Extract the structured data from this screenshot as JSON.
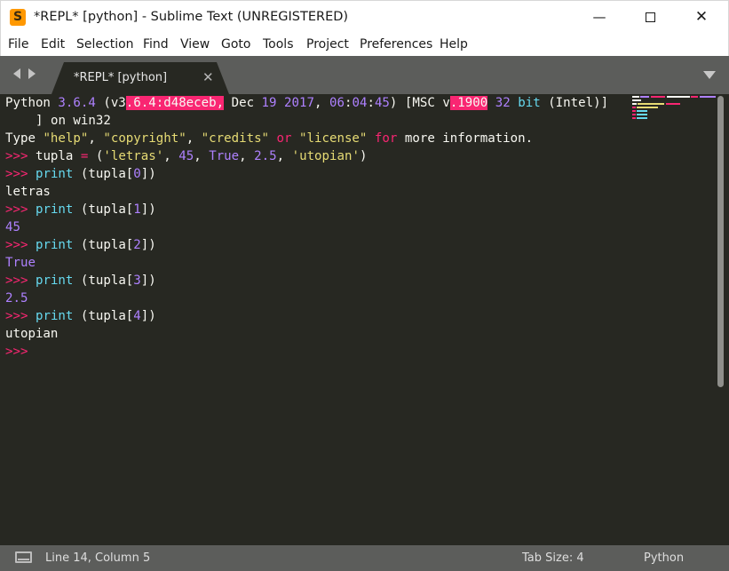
{
  "window": {
    "title": "*REPL* [python] - Sublime Text (UNREGISTERED)",
    "app_icon": "S",
    "minimize_icon": "minimize-icon",
    "maximize_icon": "maximize-icon",
    "close_icon": "close-icon",
    "close_glyph": "✕",
    "minimize_glyph": "—"
  },
  "menu": [
    "File",
    "Edit",
    "Selection",
    "Find",
    "View",
    "Goto",
    "Tools",
    "Project",
    "Preferences",
    "Help"
  ],
  "tabs": [
    {
      "label": "*REPL* [python]",
      "close_glyph": "✕",
      "active": true
    }
  ],
  "editor": {
    "lines": [
      "Python 3.6.4 (v3.6.4:d48eceb, Dec 19 2017, 06:04:45) [MSC v.1900 32 bit (Intel)]",
      "    ] on win32",
      "Type \"help\", \"copyright\", \"credits\" or \"license\" for more information.",
      ">>> tupla = ('letras', 45, True, 2.5, 'utopian')",
      ">>> print (tupla[0])",
      "letras",
      ">>> print (tupla[1])",
      "45",
      ">>> print (tupla[2])",
      "True",
      ">>> print (tupla[3])",
      "2.5",
      ">>> print (tupla[4])",
      "utopian",
      ">>>"
    ]
  },
  "status": {
    "position": "Line 14, Column 5",
    "tab_size": "Tab Size: 4",
    "syntax": "Python"
  },
  "colors": {
    "editor_bg": "#272822",
    "chrome_bg": "#5c5d5b",
    "text": "#f8f8f2",
    "keyword_pink": "#f92672",
    "number_purple": "#ae81ff",
    "string_yellow": "#e6db74",
    "builtin_cyan": "#66d9ef",
    "app_icon": "#ff9800"
  }
}
